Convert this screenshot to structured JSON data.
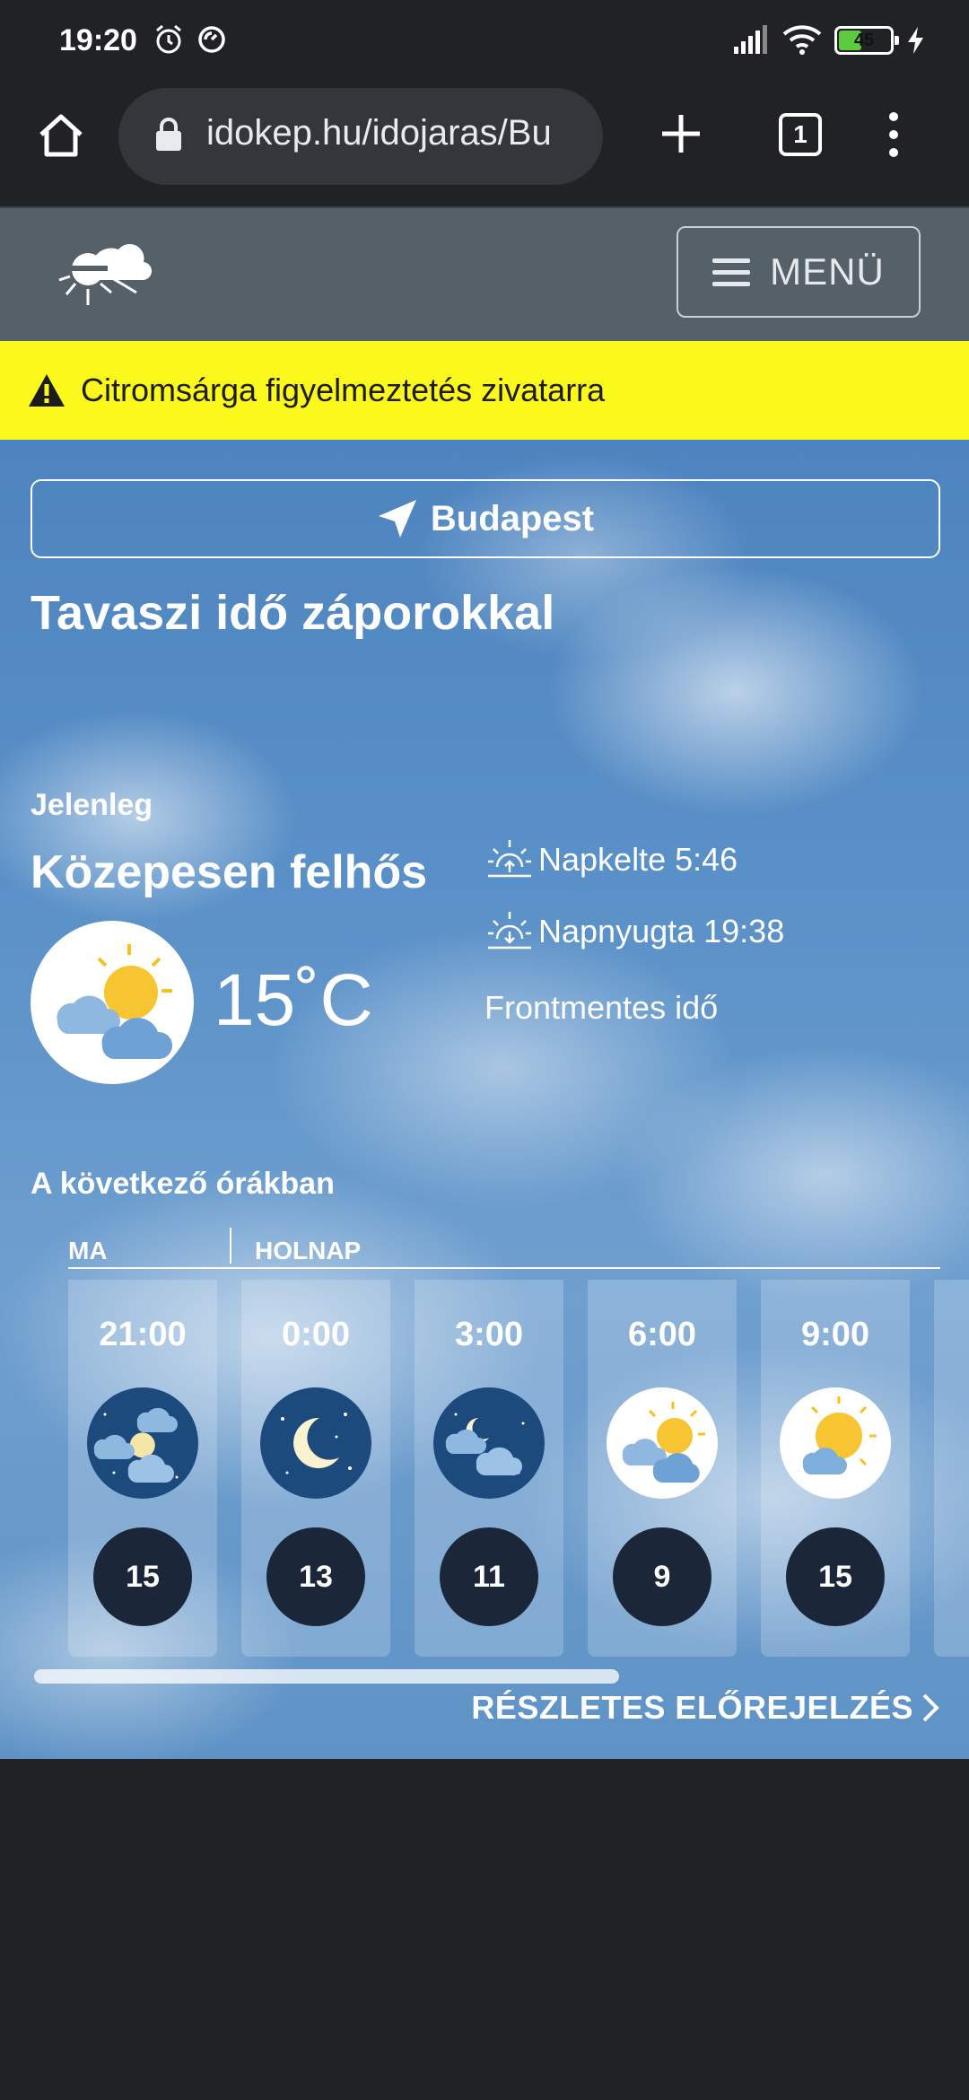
{
  "status": {
    "time": "19:20",
    "battery": "45",
    "battery_level": 0.45
  },
  "browser": {
    "url": "idokep.hu/idojaras/Bu",
    "tab_count": "1"
  },
  "header": {
    "menu_label": "MENÜ"
  },
  "warning": {
    "text": "Citromsárga figyelmeztetés zivatarra"
  },
  "location": {
    "city": "Budapest"
  },
  "headline": "Tavaszi idő záporokkal",
  "current": {
    "label": "Jelenleg",
    "condition": "Közepesen felhős",
    "temperature": "15˚C",
    "sunrise": "Napkelte 5:46",
    "sunset": "Napnyugta 19:38",
    "front": "Frontmentes idő",
    "icon": "partly-cloudy-day-icon"
  },
  "forecast": {
    "title": "A következő órákban",
    "today_label": "MA",
    "tomorrow_label": "HOLNAP",
    "hours": [
      {
        "time": "21:00",
        "temp": "15",
        "icon": "cloudy-night-icon"
      },
      {
        "time": "0:00",
        "temp": "13",
        "icon": "clear-night-icon"
      },
      {
        "time": "3:00",
        "temp": "11",
        "icon": "partly-cloudy-night-icon"
      },
      {
        "time": "6:00",
        "temp": "9",
        "icon": "partly-cloudy-day-icon"
      },
      {
        "time": "9:00",
        "temp": "15",
        "icon": "mostly-sunny-icon"
      }
    ],
    "details_link": "RÉSZLETES ELŐREJELZÉS"
  },
  "colors": {
    "warning_bg": "#fbf91b",
    "header_bg": "#556068",
    "temp_badge": "#1b2638",
    "night_icon_bg": "#1d4a7c"
  }
}
